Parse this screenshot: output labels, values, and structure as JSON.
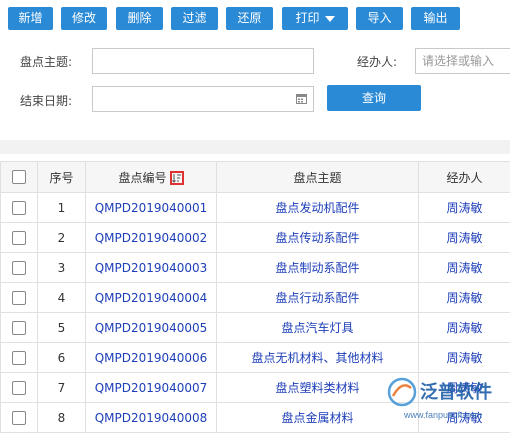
{
  "toolbar": {
    "buttons": [
      "新增",
      "修改",
      "删除",
      "过滤",
      "还原",
      "打印",
      "导入",
      "输出"
    ]
  },
  "filters": {
    "subject_label": "盘点主题:",
    "subject_value": "",
    "handler_label": "经办人:",
    "handler_placeholder": "请选择或输入",
    "end_date_label": "结束日期:",
    "end_date_value": "",
    "query_label": "查询"
  },
  "table": {
    "headers": {
      "index": "序号",
      "code": "盘点编号",
      "subject": "盘点主题",
      "handler": "经办人"
    },
    "rows": [
      {
        "index": "1",
        "code": "QMPD2019040001",
        "subject": "盘点发动机配件",
        "handler": "周涛敏"
      },
      {
        "index": "2",
        "code": "QMPD2019040002",
        "subject": "盘点传动系配件",
        "handler": "周涛敏"
      },
      {
        "index": "3",
        "code": "QMPD2019040003",
        "subject": "盘点制动系配件",
        "handler": "周涛敏"
      },
      {
        "index": "4",
        "code": "QMPD2019040004",
        "subject": "盘点行动系配件",
        "handler": "周涛敏"
      },
      {
        "index": "5",
        "code": "QMPD2019040005",
        "subject": "盘点汽车灯具",
        "handler": "周涛敏"
      },
      {
        "index": "6",
        "code": "QMPD2019040006",
        "subject": "盘点无机材料、其他材料",
        "handler": "周涛敏"
      },
      {
        "index": "7",
        "code": "QMPD2019040007",
        "subject": "盘点塑料类材料",
        "handler": "周涛敏"
      },
      {
        "index": "8",
        "code": "QMPD2019040008",
        "subject": "盘点金属材料",
        "handler": "周涛敏"
      }
    ]
  },
  "watermark": {
    "brand": "泛普软件",
    "url": "www.fanpusoft.com"
  },
  "colors": {
    "accent": "#2a8ad6",
    "link": "#1e3fb8",
    "sort_highlight": "#e03131"
  }
}
